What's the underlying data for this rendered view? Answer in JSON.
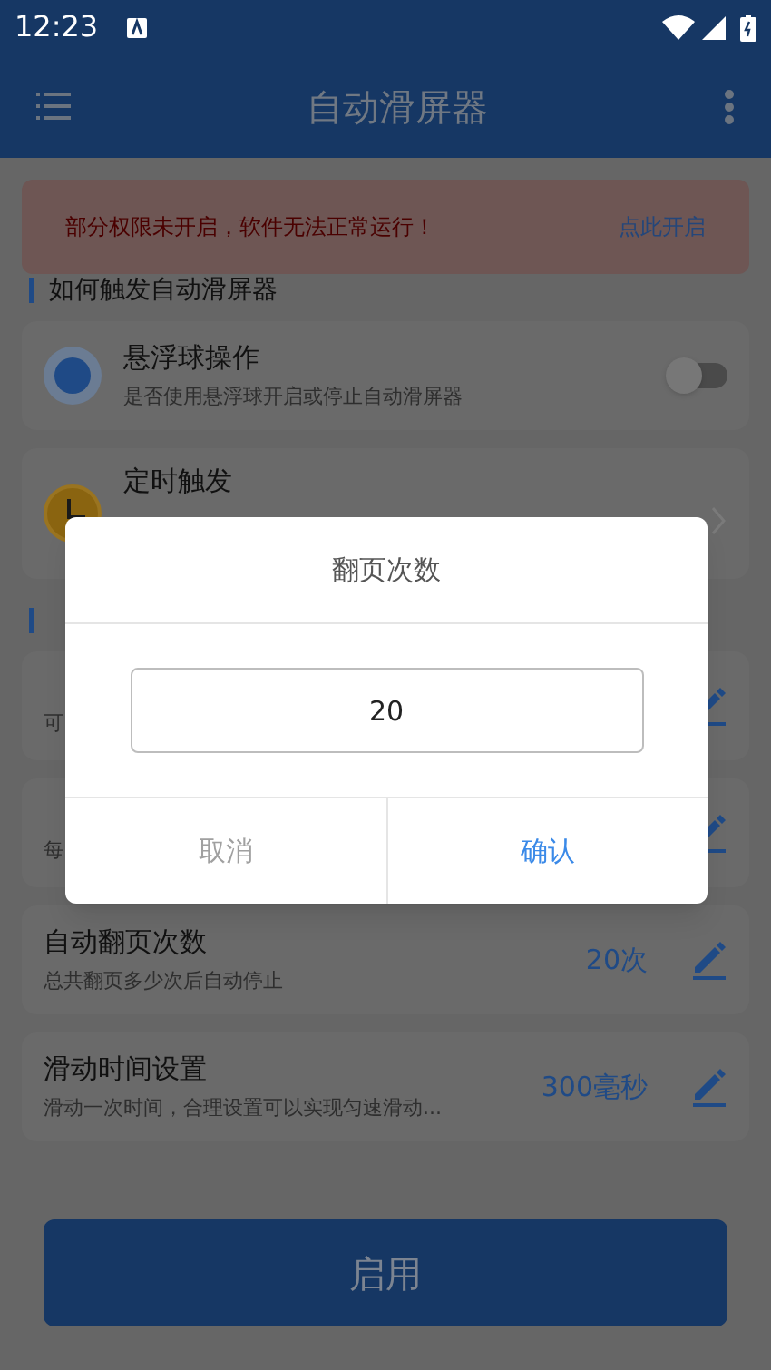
{
  "status_bar": {
    "time": "12:23"
  },
  "app_bar": {
    "title": "自动滑屏器"
  },
  "banner": {
    "message": "部分权限未开启，软件无法正常运行！",
    "action": "点此开启"
  },
  "sections": [
    {
      "title": "如何触发自动滑屏器",
      "rows": [
        {
          "kind": "toggle",
          "title": "悬浮球操作",
          "subtitle": "是否使用悬浮球开启或停止自动滑屏器",
          "on": false
        },
        {
          "kind": "link",
          "title": "定时触发"
        }
      ]
    },
    {
      "rows": [
        {
          "kind": "edit",
          "subtitle": "可"
        },
        {
          "kind": "edit",
          "subtitle": "每"
        },
        {
          "kind": "edit",
          "title": "自动翻页次数",
          "subtitle": "总共翻页多少次后自动停止",
          "value": "20次"
        },
        {
          "kind": "edit",
          "title": "滑动时间设置",
          "subtitle": "滑动一次时间，合理设置可以实现匀速滑动...",
          "value": "300毫秒"
        }
      ]
    }
  ],
  "primary_button": "启用",
  "dialog": {
    "title": "翻页次数",
    "value": "20",
    "buttons": [
      {
        "label": "取消",
        "kind": "cancel"
      },
      {
        "label": "确认",
        "kind": "confirm"
      }
    ]
  }
}
